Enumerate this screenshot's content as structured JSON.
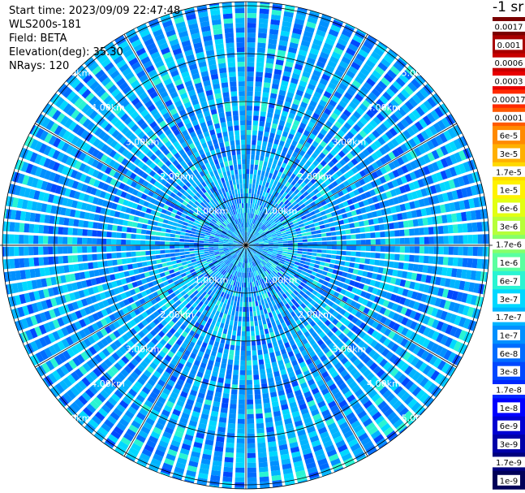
{
  "header": {
    "start_time": "Start time: 2023/09/09 22:47:48",
    "device": "WLS200s-181",
    "field": "Field: BETA",
    "elevation": "Elevation(deg): 35.30",
    "nrays": "NRays: 120"
  },
  "colorbar": {
    "unit": "-1 sr",
    "labels": [
      "0.0017",
      "0.001",
      "0.0006",
      "0.0003",
      "0.00017",
      "0.0001",
      "6e-5",
      "3e-5",
      "1.7e-5",
      "1e-5",
      "6e-6",
      "3e-6",
      "1.7e-6",
      "1e-6",
      "6e-7",
      "3e-7",
      "1.7e-7",
      "1e-7",
      "6e-8",
      "3e-8",
      "1.7e-8",
      "1e-8",
      "6e-9",
      "3e-9",
      "1.7e-9",
      "1e-9"
    ],
    "colors": [
      "#7a0000",
      "#a80000",
      "#c80000",
      "#e80000",
      "#ff2a00",
      "#ff5a00",
      "#ff8a00",
      "#ffb000",
      "#ffd800",
      "#fff200",
      "#e2ff12",
      "#b6ff3a",
      "#86ff6a",
      "#5affa0",
      "#2af4d2",
      "#00d8ff",
      "#00b4ff",
      "#0090ff",
      "#006cff",
      "#0048ff",
      "#0028ff",
      "#0000ff",
      "#0000d2",
      "#0000a8",
      "#00007e",
      "#000058"
    ]
  },
  "chart_data": {
    "type": "heatmap",
    "projection": "polar (PPI scan)",
    "field": "BETA",
    "range_rings_km": [
      1,
      2,
      3,
      4,
      5
    ],
    "ring_labels": [
      "1.00km",
      "2.00km",
      "3.00km",
      "4.00km",
      "5.00km"
    ],
    "azimuth_spokes_deg": [
      0,
      30,
      60,
      90,
      120,
      150,
      180,
      210,
      240,
      270,
      300,
      330
    ],
    "n_rays": 120,
    "value_range": [
      "1e-9",
      "0.0017"
    ],
    "dominant_values_approx": [
      "3e-8",
      "1.7e-7"
    ]
  }
}
